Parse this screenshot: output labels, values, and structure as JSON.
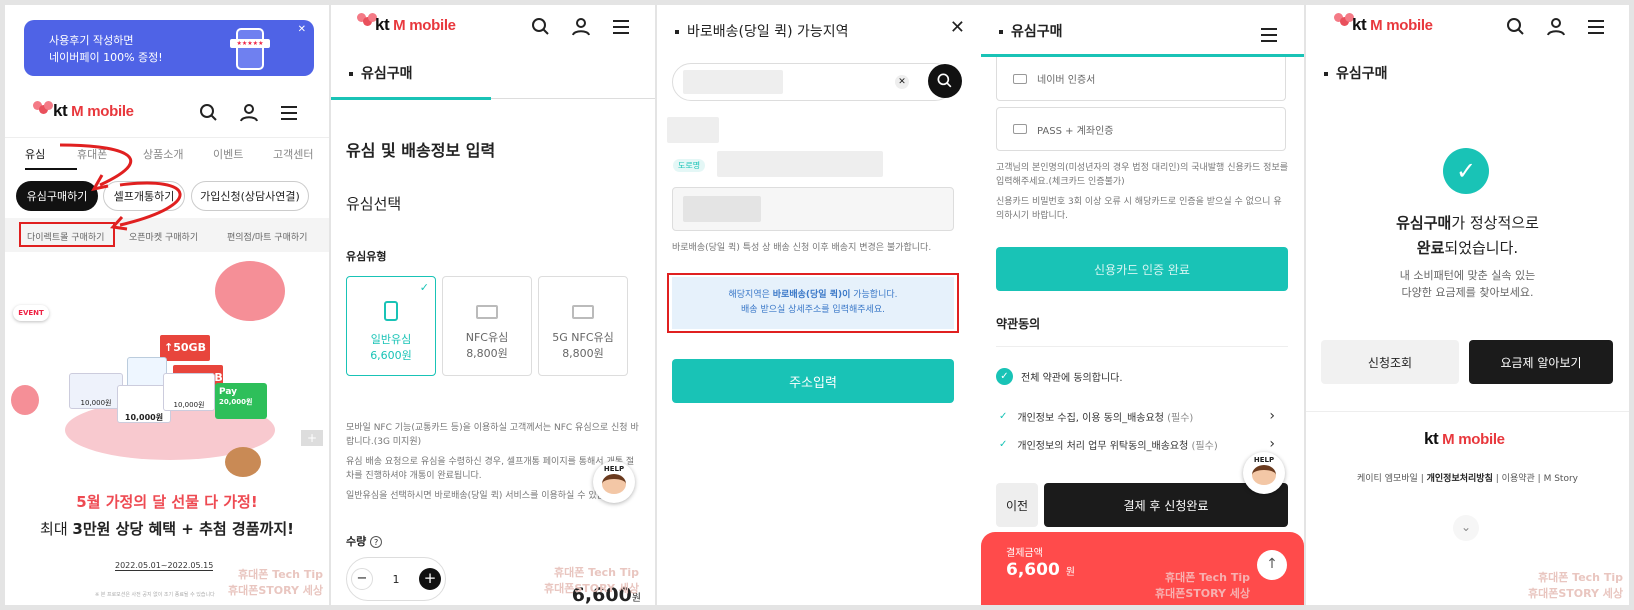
{
  "panel1": {
    "banner": {
      "line1": "사용후기 작성하면",
      "line2": "네이버페이 100% 증정!",
      "color": "#4f63e6"
    },
    "logo": {
      "brand": "kt",
      "product": "M mobile"
    },
    "nav_tabs": [
      "유심",
      "휴대폰",
      "상품소개",
      "이벤트",
      "고객센터"
    ],
    "pill_buttons": [
      "유심구매하기",
      "셀프개통하기",
      "가입신청(상담사연결)"
    ],
    "sub_links": [
      "다이렉트몰 구매하기",
      "오픈마켓 구매하기",
      "편의점/마트 구매하기"
    ],
    "event_badge": "EVENT",
    "promo_cards": [
      "↑50GB",
      "↑100GB"
    ],
    "pay_label": "Pay",
    "card_prices": [
      "10,000원",
      "10,000원",
      "10,000원",
      "20,000원"
    ],
    "headline": "5월 가정의 달 선물 다 가정!",
    "subline_prefix": "최대 ",
    "subline_bold": "3만원 상당 혜택 + 추첨 경품까지!",
    "period": "2022.05.01~2022.05.15",
    "footnote": "※ 본 프로모션은 사전 공지 없이 조기 종료될 수 있습니다",
    "plus": "+"
  },
  "panel2": {
    "logo": {
      "brand": "kt",
      "product": "M mobile"
    },
    "section_title": "유심구매",
    "heading": "유심 및 배송정보 입력",
    "usim_select": "유심선택",
    "usim_type": "유심유형",
    "cards": [
      {
        "name": "일반유심",
        "price": "6,600원"
      },
      {
        "name": "NFC유심",
        "price": "8,800원"
      },
      {
        "name": "5G NFC유심",
        "price": "8,800원"
      }
    ],
    "notes": [
      "모바일 NFC 기능(교통카드 등)을 이용하실 고객께서는 NFC 유심으로 신청 바랍니다.(3G 미지원)",
      "유심 배송 요청으로 유심을 수령하신 경우, 셀프개통 페이지를 통해서 개통 절차를 진행하셔야 개통이 완료됩니다.",
      "일반유심을 선택하시면 바로배송(당일 퀵) 서비스를 이용하실 수 있습니다."
    ],
    "qty_label": "수량",
    "qty_value": "1",
    "qty_minus": "−",
    "qty_plus": "+",
    "price": "6,600",
    "price_unit": "원",
    "help": "HELP"
  },
  "panel3": {
    "title": "바로배송(당일 퀵) 가능지역",
    "road_tag": "도로명",
    "notice": "바로배송(당일 퀵) 특성 상 배송 신청 이후 배송지 변경은 불가합니다.",
    "info_line1_a": "해당지역은 ",
    "info_line1_b": "바로배송(당일 퀵)이",
    "info_line1_c": " 가능합니다.",
    "info_line2": "배송 받으실 상세주소를 입력해주세요.",
    "address_button": "주소입력"
  },
  "panel4": {
    "section_title": "유심구매",
    "auth_options": [
      "네이버 인증서",
      "PASS + 계좌인증"
    ],
    "notes": [
      "고객님의 본인명의(미성년자의 경우 법정 대리인)의 국내발행 신용카드 정보를 입력해주세요.(체크카드 인증불가)",
      "신용카드 비밀번호 3회 이상 오류 시 해당카드로 인증을 받으실 수 없으니 유의하시기 바랍니다."
    ],
    "card_auth_done": "신용카드 인증 완료",
    "terms_title": "약관동의",
    "agree_all": "전체 약관에 동의합니다.",
    "terms": [
      {
        "label": "개인정보 수집, 이용 동의_배송요청",
        "req": "(필수)"
      },
      {
        "label": "개인정보의 처리 업무 위탁동의_배송요청",
        "req": "(필수)"
      }
    ],
    "prev": "이전",
    "submit": "결제 후 신청완료",
    "amount_label": "결제금액",
    "amount": "6,600",
    "amount_unit": "원",
    "help": "HELP",
    "accent": "#ff4b4b"
  },
  "panel5": {
    "logo": {
      "brand": "kt",
      "product": "M mobile"
    },
    "section_title": "유심구매",
    "msg1_bold": "유심구매",
    "msg1_rest": "가 정상적으로",
    "msg2_bold": "완료",
    "msg2_rest": "되었습니다.",
    "sub1": "내 소비패턴에 맞춘 실속 있는",
    "sub2": "다양한 요금제를 찾아보세요.",
    "btn_lookup": "신청조회",
    "btn_plans": "요금제 알아보기",
    "footer_links": [
      "케이티 엠모바일",
      "개인정보처리방침",
      "이용약관",
      "M Story"
    ],
    "sep": "|"
  },
  "watermark": {
    "line1": "휴대폰 Tech Tip",
    "line2": "휴대폰STORY 세상"
  },
  "teal": "#19c3b6"
}
